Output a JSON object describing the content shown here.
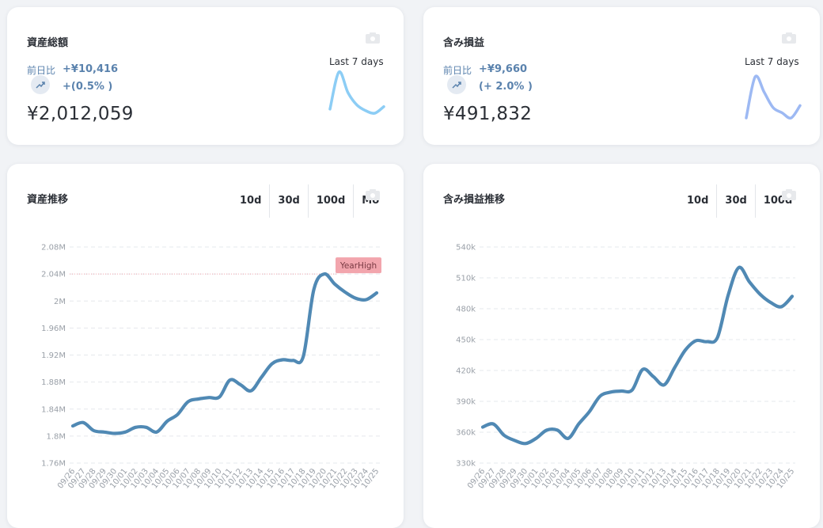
{
  "cards": {
    "total_assets": {
      "title": "資産総額",
      "prev_day_label": "前日比",
      "change_amount": "+¥10,416",
      "change_percent": "+(0.5% )",
      "value": "¥2,012,059",
      "spark_label": "Last 7 days",
      "spark_color": "#8ccdf5"
    },
    "unrealized": {
      "title": "含み損益",
      "prev_day_label": "前日比",
      "change_amount": "+¥9,660",
      "change_percent": "(+ 2.0% )",
      "value": "¥491,832",
      "spark_label": "Last 7 days",
      "spark_color": "#9db9f3"
    },
    "asset_trend": {
      "title": "資産推移",
      "tabs": [
        "10d",
        "30d",
        "100d",
        "Mo"
      ]
    },
    "pl_trend": {
      "title": "含み損益推移",
      "tabs": [
        "10d",
        "30d",
        "100d"
      ]
    }
  },
  "icons": [
    "camera-icon",
    "trend-up-icon"
  ],
  "colors": {
    "line": "#5089b4",
    "marker": "#f2a5ad",
    "grid": "#e5e8ec"
  },
  "chart_data": [
    {
      "type": "line",
      "title": "",
      "categories": [
        "09/26",
        "09/27",
        "09/28",
        "09/29",
        "09/30",
        "10/01",
        "10/02",
        "10/03",
        "10/04",
        "10/05",
        "10/06",
        "10/07",
        "10/08",
        "10/09",
        "10/10",
        "10/11",
        "10/12",
        "10/13",
        "10/14",
        "10/15",
        "10/16",
        "10/17",
        "10/18",
        "10/19",
        "10/20",
        "10/21",
        "10/22",
        "10/23",
        "10/24",
        "10/25"
      ],
      "series": [
        {
          "values": [
            1.815,
            1.82,
            1.808,
            1.806,
            1.804,
            1.806,
            1.813,
            1.813,
            1.806,
            1.822,
            1.832,
            1.851,
            1.855,
            1.857,
            1.858,
            1.883,
            1.876,
            1.867,
            1.887,
            1.907,
            1.913,
            1.912,
            1.918,
            2.017,
            2.04,
            2.025,
            2.013,
            2.004,
            2.002,
            2.012
          ]
        }
      ],
      "ylim": [
        1.76,
        2.08
      ],
      "y_ticks": [
        "1.76M",
        "1.8M",
        "1.84M",
        "1.88M",
        "1.92M",
        "1.96M",
        "2M",
        "2.04M",
        "2.08M"
      ],
      "y_tick_values": [
        1.76,
        1.8,
        1.84,
        1.88,
        1.92,
        1.96,
        2.0,
        2.04,
        2.08
      ],
      "markline": {
        "label": "YearHigh",
        "value": 2.04
      },
      "grid": true
    },
    {
      "type": "line",
      "title": "",
      "categories": [
        "09/26",
        "09/27",
        "09/28",
        "09/29",
        "09/30",
        "10/01",
        "10/02",
        "10/03",
        "10/04",
        "10/05",
        "10/06",
        "10/07",
        "10/08",
        "10/09",
        "10/10",
        "10/11",
        "10/12",
        "10/13",
        "10/14",
        "10/15",
        "10/16",
        "10/17",
        "10/18",
        "10/19",
        "10/20",
        "10/21",
        "10/22",
        "10/23",
        "10/24",
        "10/25"
      ],
      "series": [
        {
          "values": [
            365,
            368,
            357,
            352,
            349,
            354,
            362,
            362,
            354,
            368,
            380,
            395,
            399,
            400,
            401,
            421,
            414,
            406,
            423,
            440,
            449,
            448,
            452,
            493,
            520,
            506,
            494,
            486,
            482,
            492
          ]
        }
      ],
      "ylim": [
        330,
        540
      ],
      "y_ticks": [
        "330k",
        "360k",
        "390k",
        "420k",
        "450k",
        "480k",
        "510k",
        "540k"
      ],
      "y_tick_values": [
        330,
        360,
        390,
        420,
        450,
        480,
        510,
        540
      ],
      "grid": true
    }
  ],
  "sparks": {
    "total_assets": [
      2.0,
      2.045,
      2.02,
      2.005,
      1.998,
      1.995,
      2.003
    ],
    "unrealized": [
      480,
      520,
      505,
      490,
      485,
      480,
      492
    ]
  }
}
